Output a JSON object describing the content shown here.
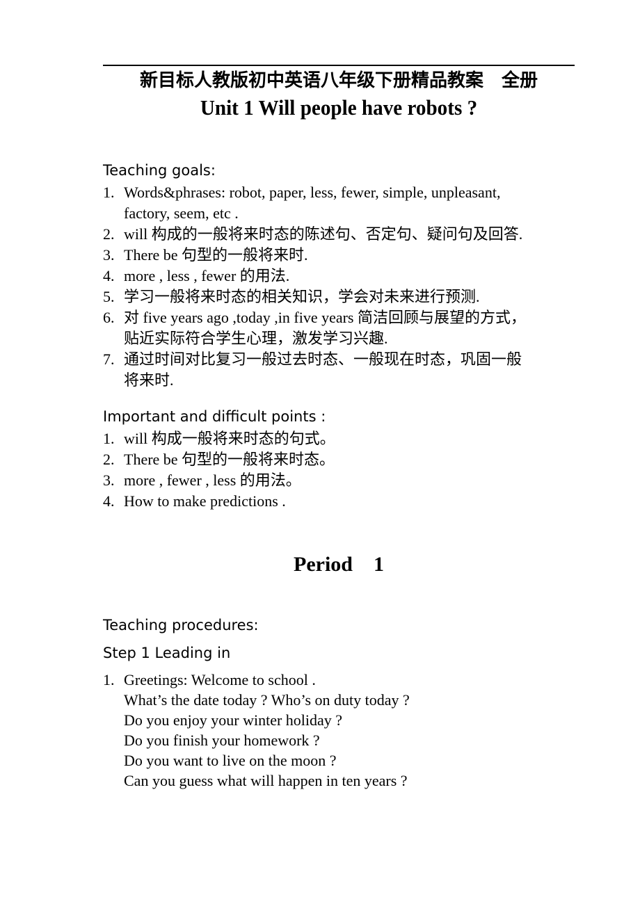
{
  "document": {
    "header_subtitle": "新目标人教版初中英语八年级下册精品教案　全册",
    "title": "Unit 1 Will people have robots ?",
    "period_heading": "Period    1"
  },
  "teaching_goals": {
    "heading": "Teaching goals:",
    "items": [
      {
        "num": "1.",
        "lines": [
          "Words&phrases:  robot,  paper,  less,  fewer,  simple,  unpleasant,",
          "factory, seem, etc ."
        ]
      },
      {
        "num": "2.",
        "lines": [
          "will  构成的一般将来时态的陈述句、否定句、疑问句及回答."
        ]
      },
      {
        "num": "3.",
        "lines": [
          "There be  句型的一般将来时."
        ]
      },
      {
        "num": "4.",
        "lines": [
          "more , less , fewer  的用法."
        ]
      },
      {
        "num": "5.",
        "lines": [
          "学习一般将来时态的相关知识，学会对未来进行预测."
        ]
      },
      {
        "num": "6.",
        "lines": [
          "对 five years ago ,today ,in five years  简洁回顾与展望的方式，",
          "贴近实际符合学生心理，激发学习兴趣."
        ]
      },
      {
        "num": "7.",
        "lines": [
          "通过时间对比复习一般过去时态、一般现在时态，巩固一般",
          "将来时."
        ]
      }
    ]
  },
  "important_points": {
    "heading": "Important and difficult points :",
    "items": [
      {
        "num": "1.",
        "lines": [
          "will 构成一般将来时态的句式。"
        ]
      },
      {
        "num": "2.",
        "lines": [
          "There be  句型的一般将来时态。"
        ]
      },
      {
        "num": "3.",
        "lines": [
          "more , fewer , less  的用法。"
        ]
      },
      {
        "num": "4.",
        "lines": [
          "How to make predictions ."
        ]
      }
    ]
  },
  "procedures": {
    "heading": "Teaching procedures:",
    "step_heading": "Step 1   Leading in",
    "items": [
      {
        "num": "1.",
        "lines": [
          "Greetings: Welcome to school .",
          "What’s the date today ? Who’s on duty today ?",
          "Do you enjoy your winter holiday ?",
          "Do you finish your homework ?",
          "Do you want to live on the moon ?",
          "Can you guess what will happen in ten years ?"
        ]
      }
    ]
  }
}
